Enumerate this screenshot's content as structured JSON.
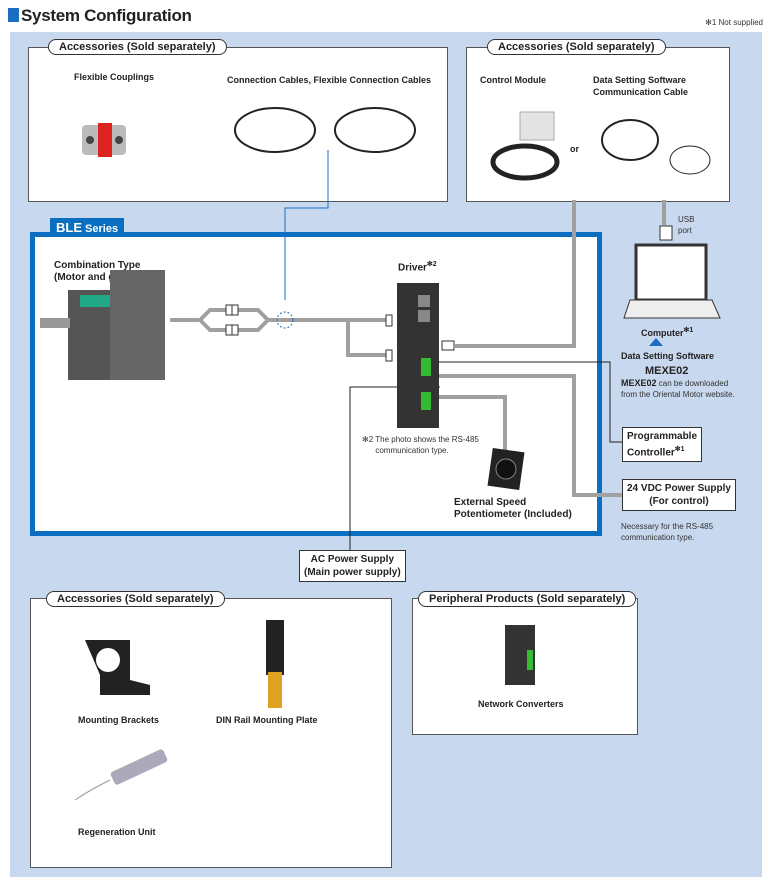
{
  "title": "System Configuration",
  "note": "✻1 Not supplied",
  "top_left": {
    "header": "Accessories (Sold separately)",
    "items": [
      "Flexible Couplings",
      "Connection Cables, Flexible Connection Cables"
    ]
  },
  "top_right": {
    "header": "Accessories (Sold separately)",
    "items": [
      "Control Module",
      "Data Setting Software\nCommunication Cable"
    ],
    "or": "or"
  },
  "ble": {
    "series": "BLE",
    "series_suffix": " Series",
    "combination": "Combination Type\n(Motor and gearhead)",
    "driver": "Driver",
    "driver_note_mark": "✻2",
    "driver_note": "✻2 The photo shows the RS-485\n      communication type.",
    "potentiometer": "External Speed\nPotentiometer (Included)"
  },
  "usb_port": "USB\nport",
  "computer": {
    "label": "Computer",
    "mark": "✻1",
    "software_label": "Data Setting Software",
    "software_name": "MEXE02",
    "download_name": "MEXE02",
    "download_text": " can be downloaded\nfrom the Oriental Motor website."
  },
  "plc": {
    "label": "Programmable\nController",
    "mark": "✻1"
  },
  "power24": {
    "label": "24 VDC Power Supply\n(For control)",
    "note": "Necessary for the RS-485\ncommunication type."
  },
  "ac": {
    "label": "AC Power Supply\n(Main power supply)"
  },
  "bottom_left": {
    "header": "Accessories (Sold separately)",
    "items": [
      "Mounting Brackets",
      "DIN Rail Mounting Plate",
      "Regeneration Unit"
    ]
  },
  "bottom_right": {
    "header": "Peripheral Products (Sold separately)",
    "items": [
      "Network Converters"
    ]
  },
  "colors": {
    "accent": "#0a6fc0",
    "background": "#c8d8ee",
    "line": "#a0a0a0"
  }
}
